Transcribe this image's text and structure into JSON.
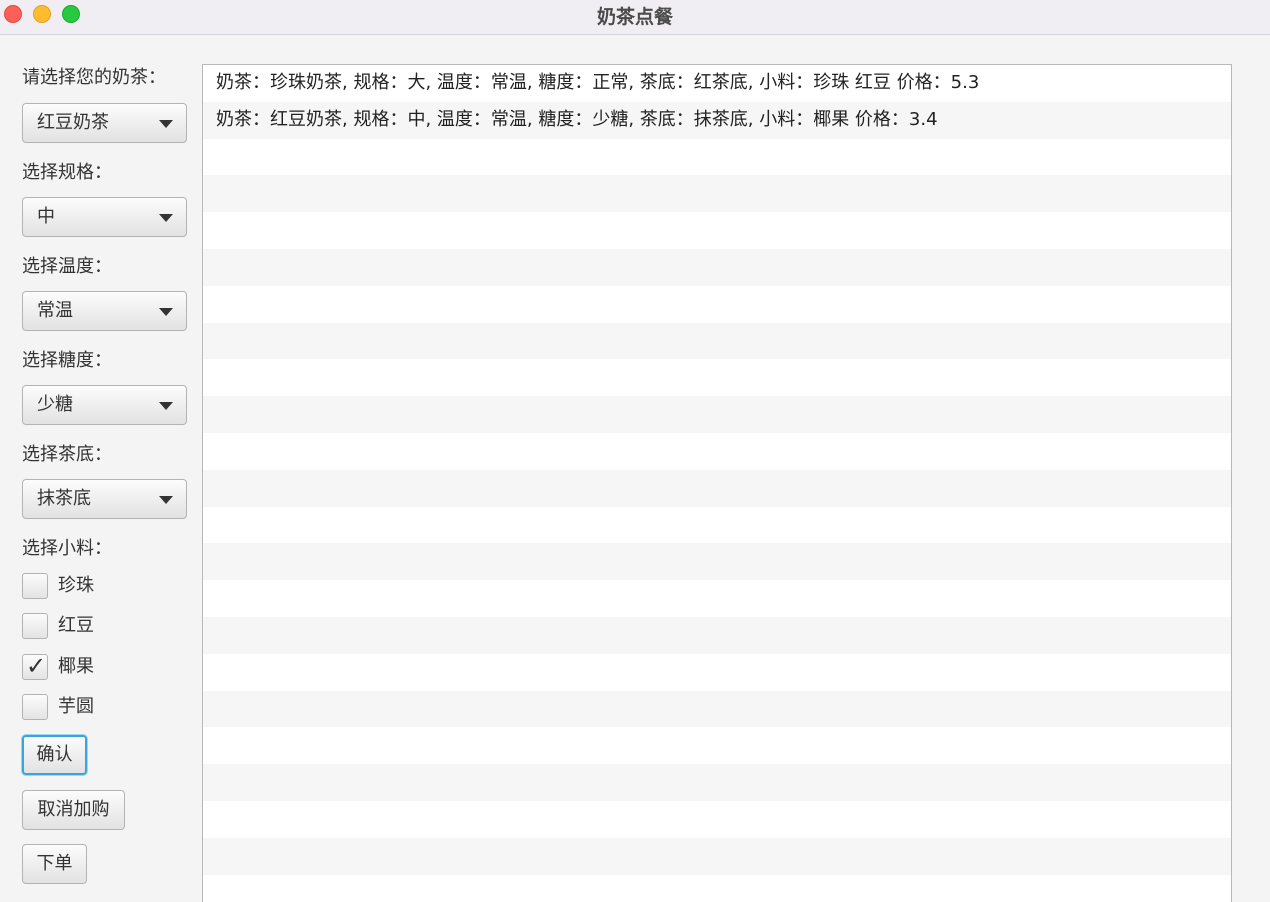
{
  "window": {
    "title": "奶茶点餐"
  },
  "form": {
    "tea_label": "请选择您的奶茶：",
    "tea_value": "红豆奶茶",
    "size_label": "选择规格：",
    "size_value": "中",
    "temp_label": "选择温度：",
    "temp_value": "常温",
    "sugar_label": "选择糖度：",
    "sugar_value": "少糖",
    "base_label": "选择茶底：",
    "base_value": "抹茶底",
    "topping_label": "选择小料：",
    "toppings": [
      {
        "label": "珍珠",
        "checked": false
      },
      {
        "label": "红豆",
        "checked": false
      },
      {
        "label": "椰果",
        "checked": true
      },
      {
        "label": "芋圆",
        "checked": false
      }
    ]
  },
  "buttons": {
    "confirm": "确认",
    "cancel": "取消加购",
    "order": "下单"
  },
  "orders": [
    "奶茶：珍珠奶茶, 规格：大, 温度：常温, 糖度：正常, 茶底：红茶底, 小料：珍珠 红豆  价格：5.3",
    "奶茶：红豆奶茶, 规格：中, 温度：常温, 糖度：少糖, 茶底：抹茶底, 小料：椰果  价格：3.4"
  ],
  "icons": {
    "dropdown": "chevron-down-icon",
    "check": "checkmark-icon"
  },
  "colors": {
    "focus_ring": "#3aa5dc",
    "close": "#fe5f57",
    "minimize": "#febc2e",
    "maximize": "#28c840"
  }
}
